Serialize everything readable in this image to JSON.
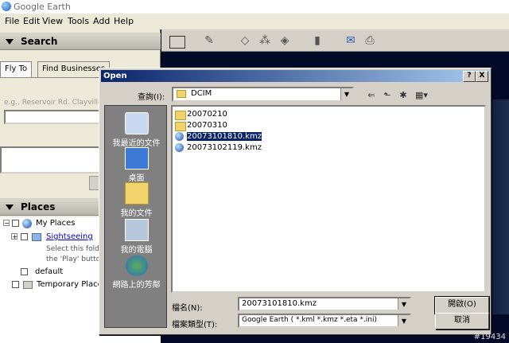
{
  "app": {
    "title": "Google Earth"
  },
  "menu": [
    "File",
    "Edit",
    "View",
    "Tools",
    "Add",
    "Help"
  ],
  "search_panel": {
    "title": "Search",
    "tabs": [
      "Fly To",
      "Find Businesses"
    ],
    "placeholder_hint": "e.g., Reservoir Rd. Clayville"
  },
  "places_panel": {
    "title": "Places",
    "items": [
      {
        "label": "My Places"
      },
      {
        "label": "Sightseeing"
      },
      {
        "label": "Select this folde"
      },
      {
        "label": "the 'Play' button"
      },
      {
        "label": "default"
      },
      {
        "label": "Temporary Places"
      }
    ]
  },
  "dialog": {
    "title": "Open",
    "help_btn": "?",
    "close_btn": "X",
    "look_in_label": "查詢(I):",
    "look_in_value": "DCIM",
    "places": [
      {
        "label": "我最近的文件",
        "icon": "recent-docs-icon"
      },
      {
        "label": "桌面",
        "icon": "desktop-icon"
      },
      {
        "label": "我的文件",
        "icon": "my-documents-icon"
      },
      {
        "label": "我的電腦",
        "icon": "my-computer-icon"
      },
      {
        "label": "網路上的芳鄰",
        "icon": "network-icon"
      }
    ],
    "files": [
      {
        "name": "20070210",
        "type": "folder"
      },
      {
        "name": "20070310",
        "type": "folder"
      },
      {
        "name": "20073101810.kmz",
        "type": "kmz",
        "selected": true
      },
      {
        "name": "20073102119.kmz",
        "type": "kmz"
      }
    ],
    "filename_label": "檔名(N):",
    "filename_value": "20073101810.kmz",
    "filetype_label": "檔案類型(T):",
    "filetype_value": "Google Earth ( *.kml *.kmz *.eta *.ini)",
    "open_btn": "開啟(O)",
    "cancel_btn": "取消"
  },
  "watermark": "#19434"
}
